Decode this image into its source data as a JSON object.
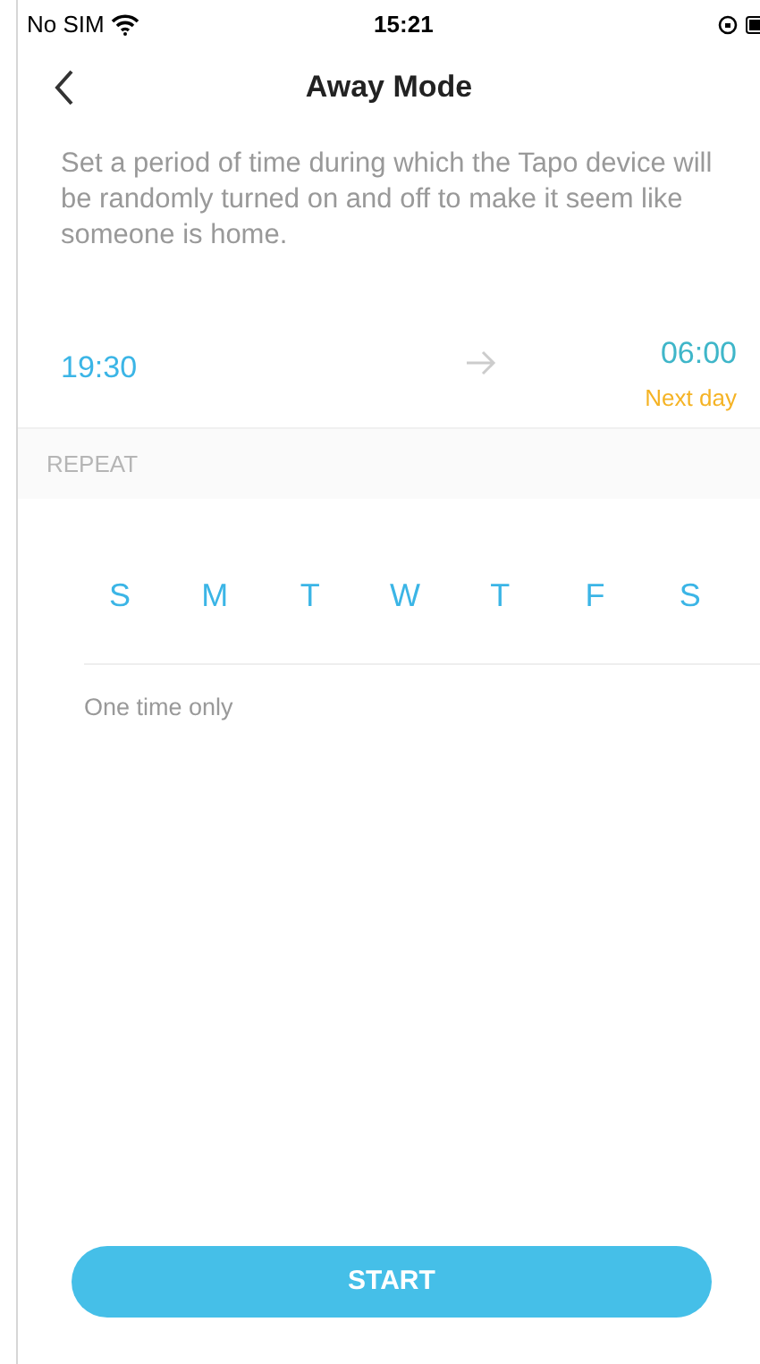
{
  "status_bar": {
    "carrier": "No SIM",
    "time": "15:21"
  },
  "header": {
    "title": "Away Mode"
  },
  "description": "Set a period of time during which the Tapo device will be randomly turned on and off to make it seem like someone is home.",
  "period": {
    "start": "19:30",
    "end": "06:00",
    "end_note": "Next day"
  },
  "repeat": {
    "label": "REPEAT",
    "days": [
      {
        "label": "S",
        "selected": false
      },
      {
        "label": "M",
        "selected": false
      },
      {
        "label": "T",
        "selected": false
      },
      {
        "label": "W",
        "selected": false
      },
      {
        "label": "T",
        "selected": false
      },
      {
        "label": "F",
        "selected": false
      },
      {
        "label": "S",
        "selected": false
      }
    ],
    "summary": "One time only"
  },
  "start_button": "START"
}
